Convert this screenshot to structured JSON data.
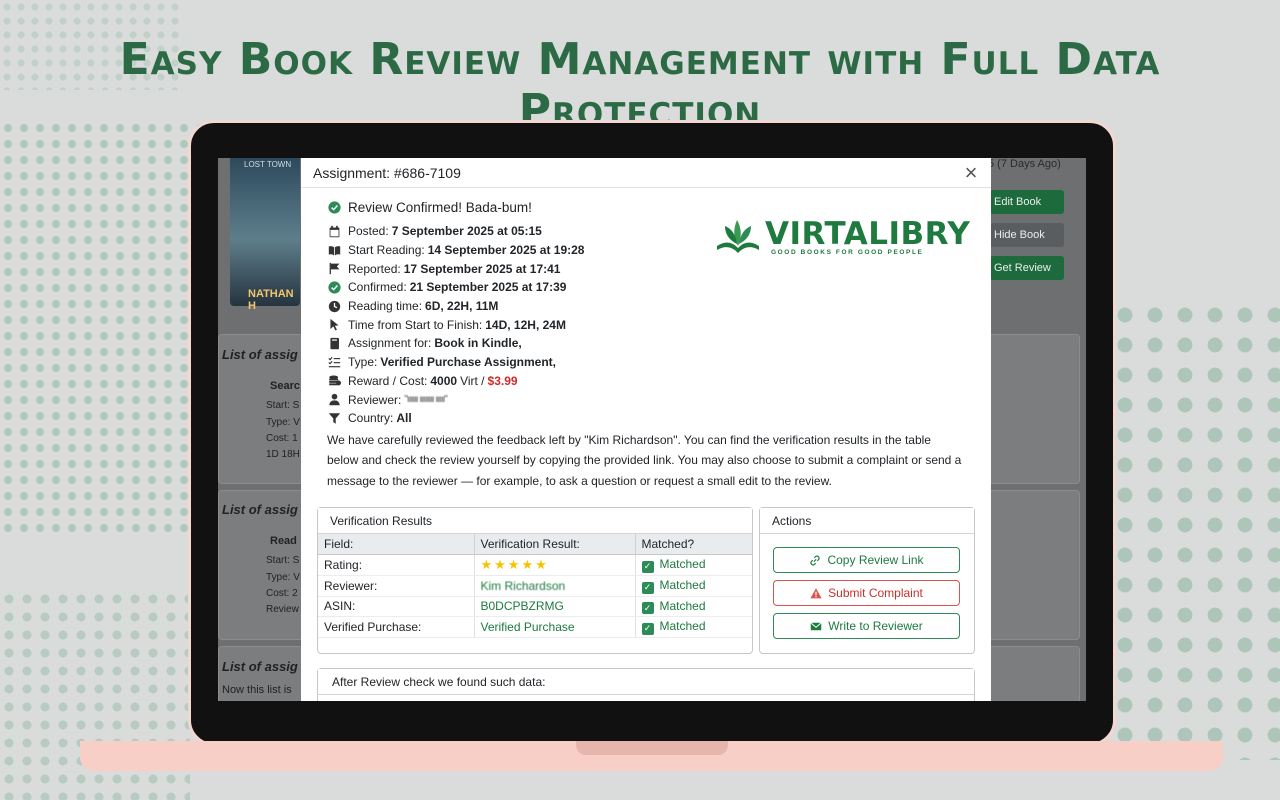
{
  "headline": "Easy Book Review Management with Full Data Protection",
  "background": {
    "book_title": "LOST TOWN",
    "book_author": "NATHAN H",
    "date_posted": "5 (7 Days Ago)",
    "buttons": {
      "edit": "Edit Book",
      "hide": "Hide Book",
      "get": "Get Review"
    },
    "sections": [
      {
        "label": "List of assig",
        "title": "Searc",
        "start": "Start: S",
        "type": "Type: V",
        "cost": "Cost: 1",
        "extra": "1D 18H"
      },
      {
        "label": "List of assig",
        "title": "Read",
        "start": "Start: S",
        "type": "Type: V",
        "cost": "Cost: 2",
        "extra": "Review"
      },
      {
        "label": "List of assig",
        "note": "Now this list is"
      }
    ]
  },
  "modal": {
    "title": "Assignment: #686-7109",
    "close_label": "×",
    "confirmed": "Review Confirmed! Bada-bum!",
    "logo": {
      "word": "VIRTALIBRY",
      "tagline": "GOOD BOOKS FOR GOOD PEOPLE"
    },
    "details": {
      "posted": {
        "label": "Posted:",
        "value": "7 September 2025 at 05:15"
      },
      "start_reading": {
        "label": "Start Reading:",
        "value": "14 September 2025 at 19:28"
      },
      "reported": {
        "label": "Reported:",
        "value": "17 September 2025 at 17:41"
      },
      "confirmed": {
        "label": "Confirmed:",
        "value": "21 September 2025 at 17:39"
      },
      "reading_time": {
        "label": "Reading time:",
        "value": "6D, 22H, 11M"
      },
      "time_start_finish": {
        "label": "Time from Start to Finish:",
        "value": "14D, 12H, 24M"
      },
      "assignment_for": {
        "label": "Assignment for:",
        "value": "Book in Kindle,"
      },
      "type": {
        "label": "Type:",
        "value": "Verified Purchase Assignment,"
      },
      "reward": {
        "label": "Reward / Cost:",
        "value": "4000",
        "unit": "Virt /",
        "price": "$3.99"
      },
      "reviewer": {
        "label": "Reviewer:",
        "value": "\"ıııııı ıııııııı ııııı\""
      },
      "country": {
        "label": "Country:",
        "value": "All"
      }
    },
    "paragraph": "We have carefully reviewed the feedback left by \"Kim Richardson\". You can find the verification results in the table below and check the review yourself by copying the provided link. You may also choose to submit a complaint or send a message to the reviewer — for example, to ask a question or request a small edit to the review.",
    "verification": {
      "heading": "Verification Results",
      "columns": [
        "Field:",
        "Verification Result:",
        "Matched?"
      ],
      "rows": [
        {
          "field": "Rating:",
          "result": "★★★★★",
          "matched": "Matched"
        },
        {
          "field": "Reviewer:",
          "result": "Kim Richardson",
          "matched": "Matched"
        },
        {
          "field": "ASIN:",
          "result": "B0DCPBZRMG",
          "matched": "Matched"
        },
        {
          "field": "Verified Purchase:",
          "result": "Verified Purchase",
          "matched": "Matched"
        }
      ]
    },
    "actions": {
      "heading": "Actions",
      "copy": "Copy Review Link",
      "complaint": "Submit Complaint",
      "write": "Write to Reviewer"
    },
    "after_heading": "After Review check we found such data:"
  },
  "colors": {
    "brand": "#1e7a3f",
    "headline": "#2b6a45",
    "price": "#d12a2a",
    "star": "#f5c400"
  }
}
